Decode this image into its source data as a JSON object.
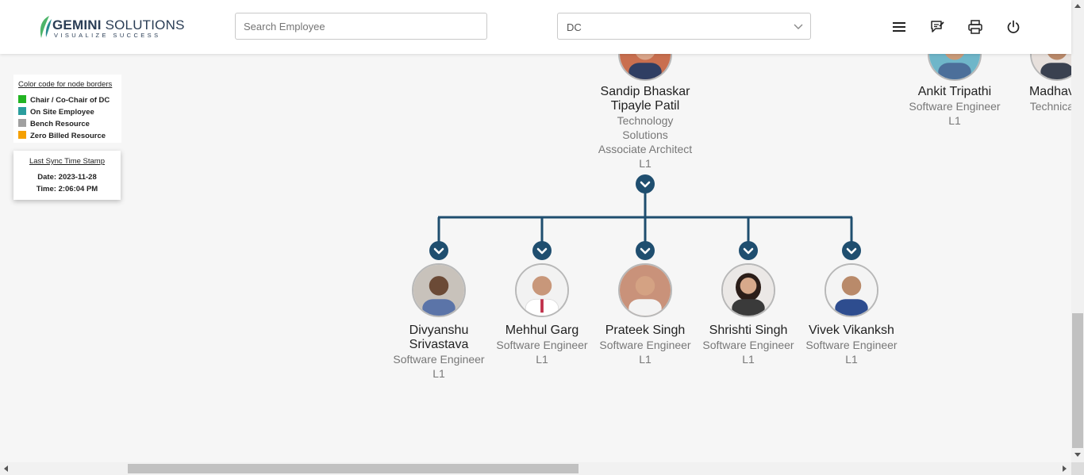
{
  "header": {
    "logo_name_bold": "GEMINI",
    "logo_name_rest": " SOLUTIONS",
    "logo_tagline": "VISUALIZE SUCCESS",
    "search_placeholder": "Search Employee",
    "search_value": "",
    "dropdown_value": "DC",
    "icons": [
      "menu-icon",
      "feedback-icon",
      "printer-icon",
      "power-icon"
    ]
  },
  "legend": {
    "title": "Color code for node borders",
    "items": [
      {
        "label": "Chair / Co-Chair of DC",
        "color": "#22b422"
      },
      {
        "label": "On Site Employee",
        "color": "#2a9d9d"
      },
      {
        "label": "Bench Resource",
        "color": "#a0a0a0"
      },
      {
        "label": "Zero Billed Resource",
        "color": "#f5a000"
      }
    ]
  },
  "sync": {
    "title": "Last Sync Time Stamp",
    "date": "Date: 2023-11-28",
    "time": "Time: 2:06:04 PM"
  },
  "org": {
    "parent": {
      "name_line1": "Sandip Bhaskar",
      "name_line2": "Tipayle Patil",
      "title_line1": "Technology",
      "title_line2": "Solutions",
      "title_line3": "Associate Architect",
      "level": "L1"
    },
    "peers": [
      {
        "name": "Ankit Tripathi",
        "title": "Software Engineer",
        "level": "L1"
      },
      {
        "name": "Madhav K",
        "title": "Technical T",
        "level": ""
      }
    ],
    "children": [
      {
        "name_line1": "Divyanshu",
        "name_line2": "Srivastava",
        "title": "Software Engineer",
        "level": "L1"
      },
      {
        "name_line1": "Mehhul Garg",
        "name_line2": "",
        "title": "Software Engineer",
        "level": "L1"
      },
      {
        "name_line1": "Prateek Singh",
        "name_line2": "",
        "title": "Software Engineer",
        "level": "L1"
      },
      {
        "name_line1": "Shrishti Singh",
        "name_line2": "",
        "title": "Software Engineer",
        "level": "L1"
      },
      {
        "name_line1": "Vivek Vikanksh",
        "name_line2": "",
        "title": "Software Engineer",
        "level": "L1"
      }
    ]
  },
  "colors": {
    "connector": "#1f4e6f",
    "brand_navy": "#2a3d55",
    "brand_green": "#4db56a"
  }
}
